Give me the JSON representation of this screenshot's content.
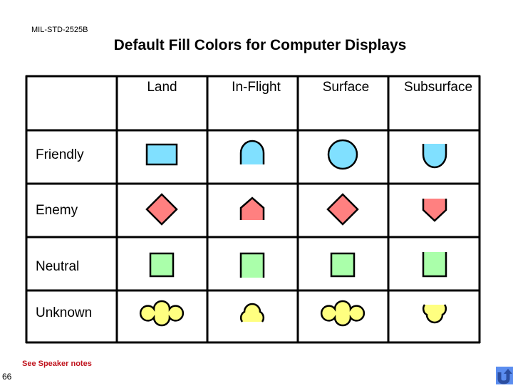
{
  "header": {
    "standard": "MIL-STD-2525B",
    "title": "Default Fill Colors for Computer Displays"
  },
  "table": {
    "columns": [
      "Land",
      "In-Flight",
      "Surface",
      "Subsurface"
    ],
    "rows": [
      {
        "label": "Friendly",
        "fill": "#80e0ff",
        "shapes": [
          "rectangle",
          "arch",
          "circle",
          "u-shape"
        ]
      },
      {
        "label": "Enemy",
        "fill": "#ff8080",
        "shapes": [
          "diamond",
          "pentagon-up",
          "diamond",
          "pentagon-down"
        ]
      },
      {
        "label": "Neutral",
        "fill": "#aaffaa",
        "shapes": [
          "square",
          "open-bottom-square",
          "square",
          "open-top-square"
        ]
      },
      {
        "label": "Unknown",
        "fill": "#ffff80",
        "shapes": [
          "quatrefoil",
          "cloud-up",
          "quatrefoil",
          "cloud-down"
        ]
      }
    ]
  },
  "footer": {
    "notes": "See Speaker notes",
    "page_number": "66",
    "notes_color": "#c0141e",
    "return_icon": "return-arrow-icon"
  }
}
